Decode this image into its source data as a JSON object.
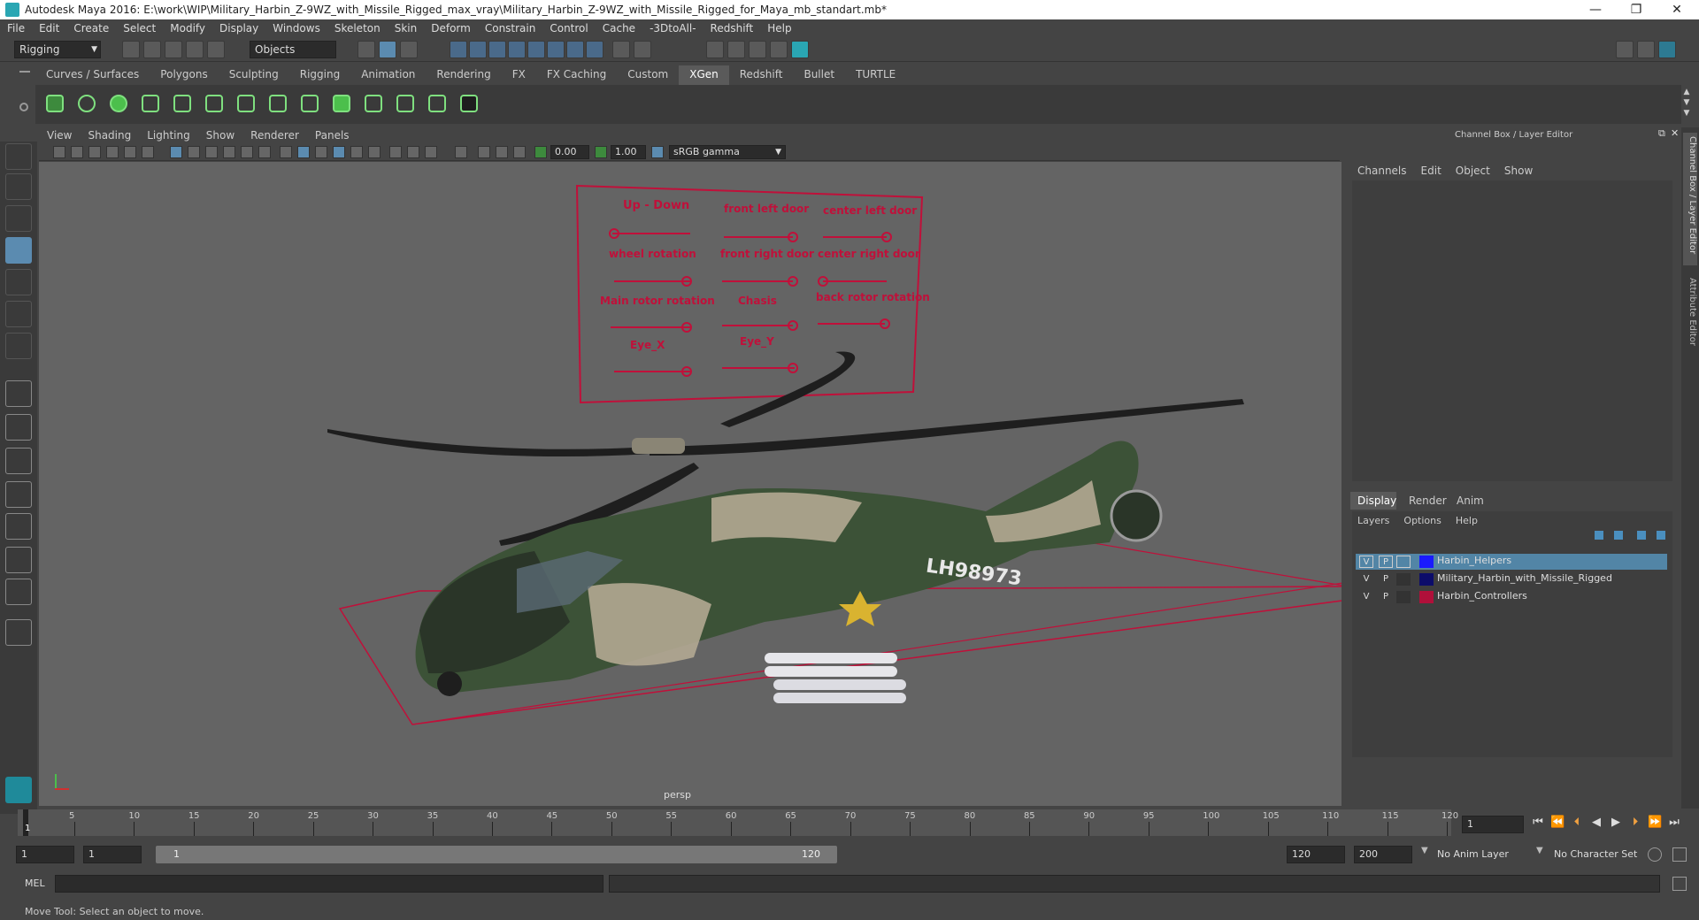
{
  "window": {
    "title": "Autodesk Maya 2016: E:\\work\\WIP\\Military_Harbin_Z-9WZ_with_Missile_Rigged_max_vray\\Military_Harbin_Z-9WZ_with_Missile_Rigged_for_Maya_mb_standart.mb*",
    "minimize": "—",
    "maximize": "❐",
    "close": "✕"
  },
  "menubar": [
    "File",
    "Edit",
    "Create",
    "Select",
    "Modify",
    "Display",
    "Windows",
    "Skeleton",
    "Skin",
    "Deform",
    "Constrain",
    "Control",
    "Cache",
    "-3DtoAll-",
    "Redshift",
    "Help"
  ],
  "toolbar": {
    "mode": "Rigging",
    "selection_mode": "Objects"
  },
  "shelf_tabs": [
    {
      "label": "Curves / Surfaces",
      "active": false
    },
    {
      "label": "Polygons",
      "active": false
    },
    {
      "label": "Sculpting",
      "active": false
    },
    {
      "label": "Rigging",
      "active": false
    },
    {
      "label": "Animation",
      "active": false
    },
    {
      "label": "Rendering",
      "active": false
    },
    {
      "label": "FX",
      "active": false
    },
    {
      "label": "FX Caching",
      "active": false
    },
    {
      "label": "Custom",
      "active": false
    },
    {
      "label": "XGen",
      "active": true
    },
    {
      "label": "Redshift",
      "active": false
    },
    {
      "label": "Bullet",
      "active": false
    },
    {
      "label": "TURTLE",
      "active": false
    }
  ],
  "viewport": {
    "menu": [
      "View",
      "Shading",
      "Lighting",
      "Show",
      "Renderer",
      "Panels"
    ],
    "exposure": "0.00",
    "gamma": "1.00",
    "color_space": "sRGB gamma",
    "camera_label": "persp",
    "controller_labels": [
      "Up - Down",
      "front left door",
      "center left door",
      "wheel rotation",
      "front right door",
      "center right door",
      "Main rotor rotation",
      "Chasis",
      "back rotor rotation",
      "Eye_X",
      "Eye_Y"
    ],
    "tail_number": "LH98973"
  },
  "channel_box": {
    "title": "Channel Box / Layer Editor",
    "menu": [
      "Channels",
      "Edit",
      "Object",
      "Show"
    ]
  },
  "layer_editor": {
    "tabs": [
      "Display",
      "Render",
      "Anim"
    ],
    "menu": [
      "Layers",
      "Options",
      "Help"
    ],
    "layers": [
      {
        "v": "V",
        "p": "P",
        "name": "Harbin_Helpers",
        "color": "#1a1aff",
        "selected": true
      },
      {
        "v": "V",
        "p": "P",
        "name": "Military_Harbin_with_Missile_Rigged",
        "color": "#0c0c6a",
        "selected": false
      },
      {
        "v": "V",
        "p": "P",
        "name": "Harbin_Controllers",
        "color": "#b0103a",
        "selected": false
      }
    ]
  },
  "side_tabs": [
    "Channel Box / Layer Editor",
    "Attribute Editor"
  ],
  "timeline": {
    "ticks": [
      "5",
      "10",
      "15",
      "20",
      "25",
      "30",
      "35",
      "40",
      "45",
      "50",
      "55",
      "60",
      "65",
      "70",
      "75",
      "80",
      "85",
      "90",
      "95",
      "100",
      "105",
      "110",
      "115",
      "120"
    ],
    "start_label": "1",
    "current_frame": "1"
  },
  "range": {
    "start": "1",
    "start2": "1",
    "slider_start": "1",
    "slider_end": "120",
    "end": "120",
    "end2": "200",
    "anim_layer": "No Anim Layer",
    "character_set": "No Character Set"
  },
  "mel_label": "MEL",
  "status": "Move Tool: Select an object to move."
}
